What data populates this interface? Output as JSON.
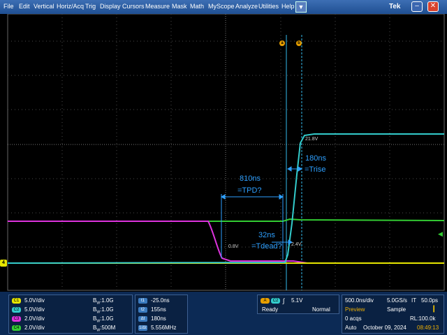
{
  "menubar": {
    "items": [
      "File",
      "Edit",
      "Vertical",
      "Horiz/Acq",
      "Trig",
      "Display",
      "Cursors",
      "Measure",
      "Mask",
      "Math",
      "MyScope",
      "Analyze",
      "Utilities",
      "Help"
    ],
    "dropdown_icon": "triangle-down",
    "brand": "Tek",
    "minimize_glyph": "–",
    "close_glyph": "✕"
  },
  "screen": {
    "cursor_a_label": "a",
    "cursor_b_label": "b",
    "annotations": {
      "tpd_value": "810ns",
      "tpd_name": "=TPD?",
      "trise_value": "180ns",
      "trise_name": "=Trise",
      "tdead_value": "32ns",
      "tdead_name": "=Tdead?"
    },
    "level_labels": {
      "l08": "0.8V",
      "l24": "2.4V",
      "l218": "21.8V"
    },
    "ground_marker": "4",
    "colors": {
      "ch1": "#e6e600",
      "ch2": "#33cccc",
      "ch3": "#dd33dd",
      "ch4": "#33cc33",
      "cursor": "#2ea0ff",
      "grid": "#555555"
    }
  },
  "channels": [
    {
      "badge": "C1",
      "scale": "5.0V/div",
      "bw": "1.0G",
      "color": "#e6e600"
    },
    {
      "badge": "C2",
      "scale": "5.0V/div",
      "bw": "1.0G",
      "color": "#33cccc"
    },
    {
      "badge": "C3",
      "scale": "2.0V/div",
      "bw": "1.0G",
      "color": "#dd33dd"
    },
    {
      "badge": "C4",
      "scale": "2.0V/div",
      "bw": "500M",
      "color": "#33cc33"
    }
  ],
  "bw_prefix": "B",
  "bw_sub": "W",
  "cursor_readouts": [
    {
      "badge": "t1",
      "value": "-25.0ns"
    },
    {
      "badge": "t2",
      "value": "155ns"
    },
    {
      "badge": "Δt",
      "value": "180ns"
    },
    {
      "badge": "1/Δt",
      "value": "5.556MHz"
    }
  ],
  "trigger": {
    "a_badge": "A",
    "ch_badge": "C2",
    "slope_glyph": "∫",
    "level": "5.1V",
    "state": "Ready",
    "mode": "Normal"
  },
  "acquisition": {
    "timebase": "500.0ns/div",
    "sample_rate": "5.0GS/s",
    "it_label": "IT",
    "it_value": "50.0ps",
    "preview": "Preview",
    "sample_mode": "Sample",
    "acqs": "0 acqs",
    "record_length": "RL:100.0k",
    "run_mode": "Auto",
    "date": "October 09, 2024",
    "time": "08:49:13"
  }
}
